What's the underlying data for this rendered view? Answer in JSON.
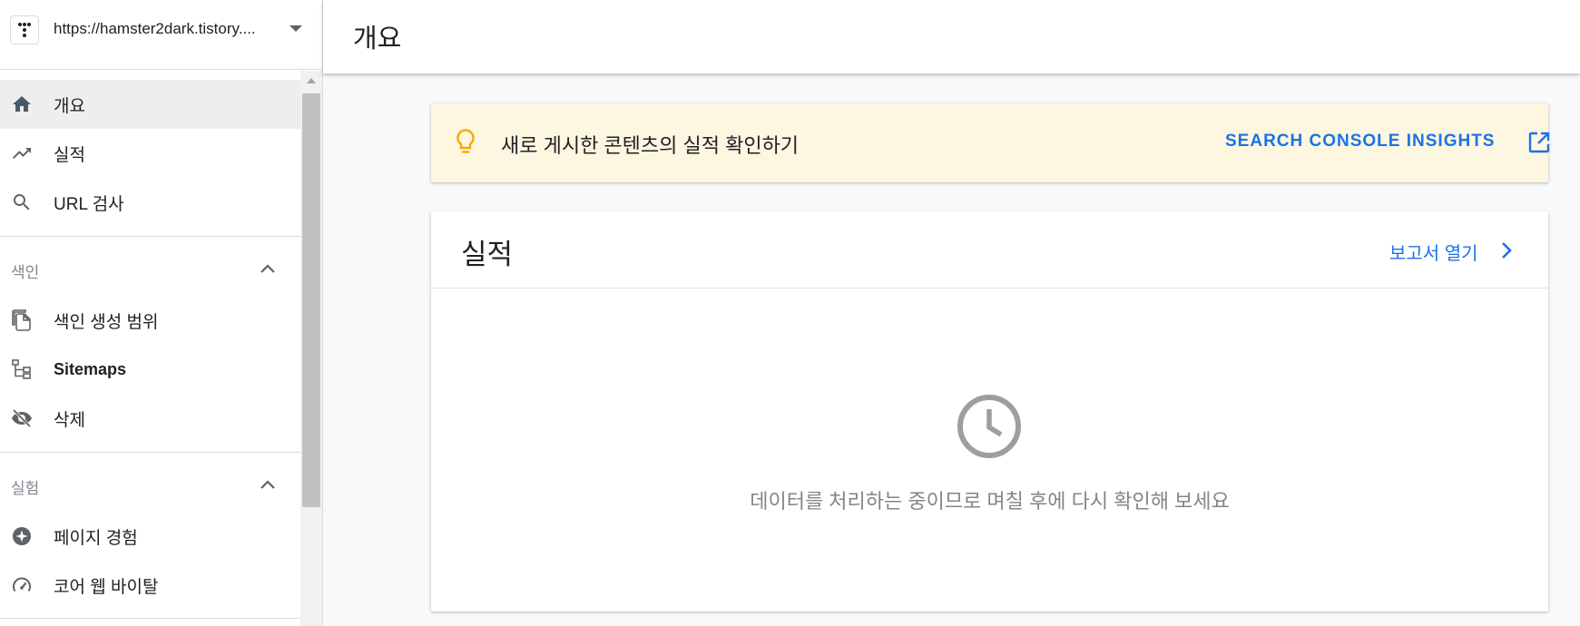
{
  "property": {
    "url": "https://hamster2dark.tistory...."
  },
  "sidebar": {
    "items": [
      {
        "label": "개요",
        "icon": "home-icon"
      },
      {
        "label": "실적",
        "icon": "trending-up-icon"
      },
      {
        "label": "URL 검사",
        "icon": "search-icon"
      }
    ],
    "sections": [
      {
        "label": "색인",
        "items": [
          {
            "label": "색인 생성 범위",
            "icon": "file-copy-icon"
          },
          {
            "label": "Sitemaps",
            "icon": "sitemap-icon"
          },
          {
            "label": "삭제",
            "icon": "visibility-off-icon"
          }
        ]
      },
      {
        "label": "실험",
        "items": [
          {
            "label": "페이지 경험",
            "icon": "star-badge-icon"
          },
          {
            "label": "코어 웹 바이탈",
            "icon": "speed-gauge-icon"
          }
        ]
      }
    ]
  },
  "header": {
    "title": "개요"
  },
  "banner": {
    "text": "새로 게시한 콘텐츠의 실적 확인하기",
    "link": "SEARCH CONSOLE INSIGHTS",
    "icon": "lightbulb-icon"
  },
  "performance_card": {
    "title": "실적",
    "link": "보고서 열기",
    "empty_message": "데이터를 처리하는 중이므로 며칠 후에 다시 확인해 보세요",
    "icon": "clock-icon"
  },
  "colors": {
    "accent": "#1a73e8",
    "banner_bg": "#fdf6e0",
    "bulb": "#f9ab00",
    "icon_gray": "#5f6368",
    "clock_gray": "#9e9e9e"
  }
}
